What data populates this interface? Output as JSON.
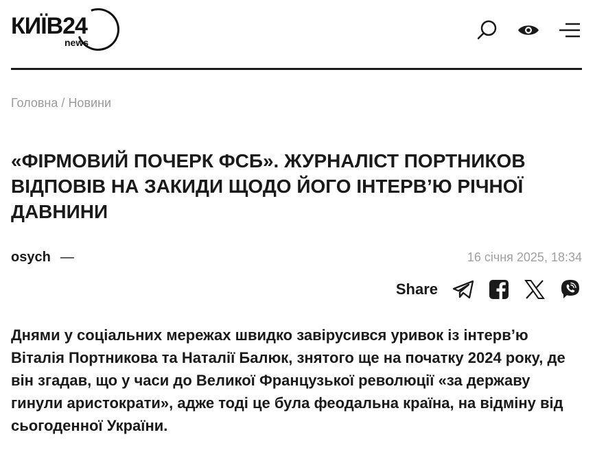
{
  "logo": {
    "main": "КИЇВ24",
    "sub": "news"
  },
  "header": {
    "icons": [
      "search-icon",
      "eye-icon",
      "menu-icon"
    ]
  },
  "breadcrumb": {
    "home": "Головна",
    "separator": "/",
    "section": "Новини"
  },
  "article": {
    "title": "«Фірмовий почерк ФСБ». Журналіст Портников відповів на закиди щодо його інтерв’ю річної давнини",
    "author": "osych",
    "author_dash": "—",
    "date": "16 січня 2025, 18:34",
    "share_label": "Share",
    "lead": "Днями у соціальних мережах швидко завірусився уривок із інтерв’ю Віталія Портникова та Наталії Балюк, знятого ще на початку 2024 року, де він згадав, що у часи до Великої Французької революції «за державу гинули аристократи», адже тоді це була феодальна країна, на відміну від сьогоденної України."
  },
  "share_icons": [
    "telegram-icon",
    "facebook-icon",
    "x-icon",
    "viber-icon"
  ],
  "colors": {
    "text": "#1a1a1a",
    "muted": "#9a9a9a",
    "background": "#ffffff"
  }
}
